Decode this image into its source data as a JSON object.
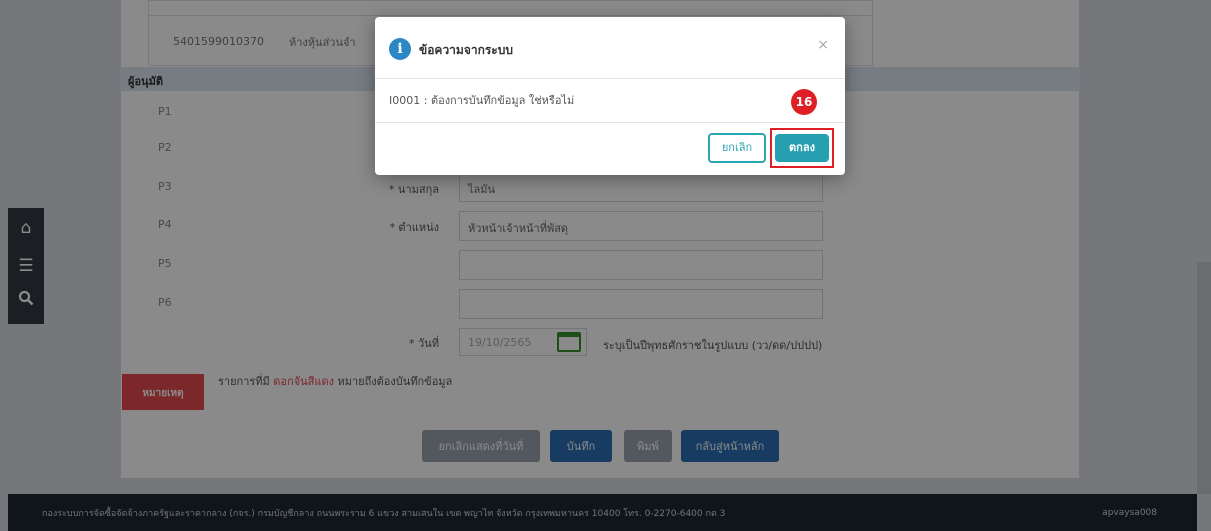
{
  "background_page": {
    "top_table": {
      "code": "5401599010370",
      "name": "ห้างหุ้นส่วนจำ"
    },
    "section_title": "ผู้อนุมัติ",
    "rows": [
      {
        "label": "P1"
      },
      {
        "label": "P2"
      },
      {
        "label": "P3",
        "field_label": "* นามสกุล",
        "value": "ไลมัน"
      },
      {
        "label": "P4",
        "field_label": "* ตำแหน่ง",
        "value": "หัวหน้าเจ้าหน้าที่พัสดุ"
      },
      {
        "label": "P5",
        "value": ""
      },
      {
        "label": "P6",
        "value": ""
      }
    ],
    "date_label": "* วันที่",
    "date_value": "19/10/2565",
    "date_hint": "ระบุเป็นปีพุทธศักราชในรูปแบบ (วว/ดด/ปปปป)",
    "note_tag": "หมายเหตุ",
    "note_prefix": "รายการที่มี",
    "note_red": "ดอกจันสีแดง",
    "note_suffix": "หมายถึงต้องบันทึกข้อมูล",
    "buttons": {
      "cancel_date": "ยกเลิกแสดงที่วันที่",
      "save": "บันทึก",
      "print": "พิมพ์",
      "home": "กลับสู่หน้าหลัก"
    },
    "footer_left": "กองระบบการจัดซื้อจัดจ้างภาครัฐและราคากลาง (กจร.) กรมบัญชีกลาง ถนนพระราม 6 แขวง สามเสนใน เขต พญาไท จังหวัด กรุงเทพมหานคร 10400 โทร. 0-2270-6400 กด 3",
    "footer_right": "apvaysa008"
  },
  "left_bar": {
    "icons": [
      "home-icon",
      "menu-icon",
      "search-icon"
    ]
  },
  "modal": {
    "icon_glyph": "i",
    "title": "ข้อความจากระบบ",
    "close": "×",
    "message": "I0001 : ต้องการบันทึกข้อมูล ใช่หรือไม่",
    "cancel_label": "ยกเลิก",
    "ok_label": "ตกลง"
  },
  "step_badge": "16",
  "colors": {
    "accent": "#26a0b0",
    "highlight": "#e01e26",
    "primary": "#2c6db3"
  }
}
